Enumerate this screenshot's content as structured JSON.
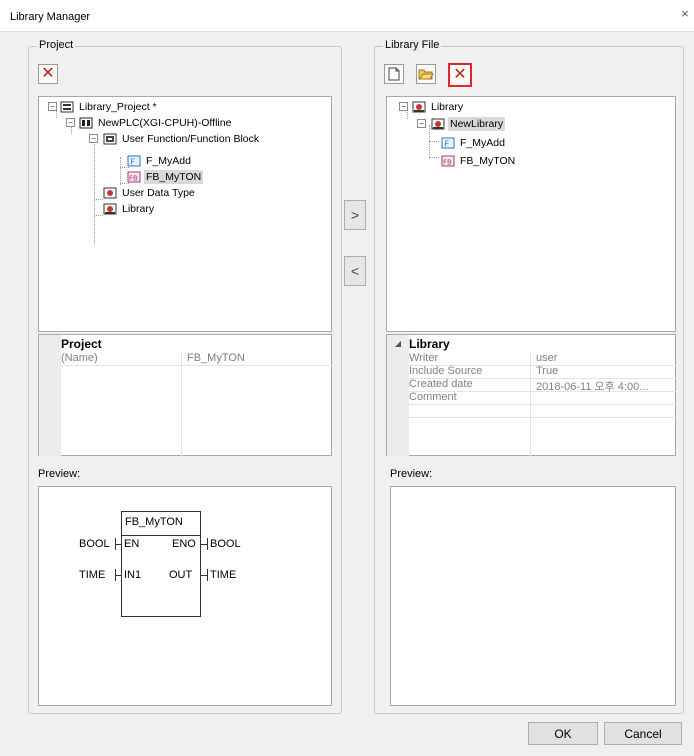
{
  "window": {
    "title": "Library Manager",
    "close_glyph": "×"
  },
  "project": {
    "group_label": "Project",
    "delete_icon": "x-mark-red",
    "tree": {
      "root": "Library_Project *",
      "plc": "NewPLC(XGI-CPUH)-Offline",
      "folder": "User Function/Function Block",
      "item1": "F_MyAdd",
      "item2": "FB_MyTON",
      "item3": "User Data Type",
      "item4": "Library"
    },
    "props": {
      "category": "Project",
      "rows": [
        {
          "key": "(Name)",
          "value": "FB_MyTON"
        }
      ]
    },
    "preview_label": "Preview:",
    "preview": {
      "fb_name": "FB_MyTON",
      "in_pin1": "EN",
      "in_type1": "BOOL",
      "in_pin2": "IN1",
      "in_type2": "TIME",
      "out_pin1": "ENO",
      "out_type1": "BOOL",
      "out_pin2": "OUT",
      "out_type2": "TIME"
    }
  },
  "library": {
    "group_label": "Library File",
    "tree": {
      "root": "Library",
      "lib": "NewLibrary",
      "item1": "F_MyAdd",
      "item2": "FB_MyTON"
    },
    "props": {
      "category": "Library",
      "rows": [
        {
          "key": "Writer",
          "value": "user"
        },
        {
          "key": "Include Source",
          "value": "True"
        },
        {
          "key": "Created date",
          "value": "2018-06-11 오후 4:00..."
        },
        {
          "key": "Comment",
          "value": ""
        }
      ]
    },
    "preview_label": "Preview:"
  },
  "transfer": {
    "add_glyph": ">",
    "remove_glyph": "<"
  },
  "footer": {
    "ok": "OK",
    "cancel": "Cancel"
  },
  "colors": {
    "accent_red": "#e0262a",
    "selection": "#d9d9d9"
  }
}
